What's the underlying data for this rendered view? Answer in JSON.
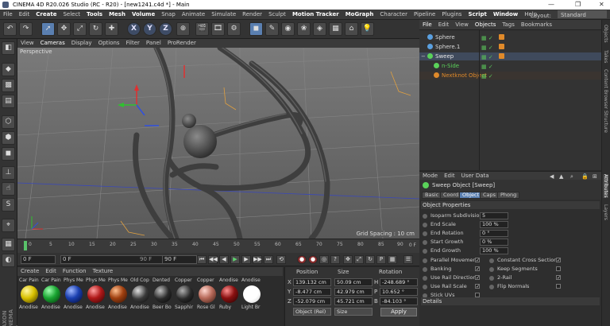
{
  "window": {
    "title": "CINEMA 4D R20.026 Studio (RC - R20) - [new1241.c4d *] - Main",
    "minimize": "—",
    "maximize": "❐",
    "close": "✕"
  },
  "menubar": {
    "items": [
      "File",
      "Edit",
      "Create",
      "Select",
      "Tools",
      "Mesh",
      "Volume",
      "Snap",
      "Animate",
      "Simulate",
      "Render",
      "Sculpt",
      "Motion Tracker",
      "MoGraph",
      "Character",
      "Pipeline",
      "Plugins",
      "Script",
      "Window",
      "Help"
    ],
    "highlighted": [
      "Create",
      "Tools",
      "Mesh",
      "Volume",
      "Motion Tracker",
      "MoGraph",
      "Script",
      "Window"
    ],
    "layout_label": "Layout:",
    "layout_value": "Standard"
  },
  "toolbar": {
    "xyz": [
      "X",
      "Y",
      "Z"
    ]
  },
  "viewport": {
    "menu": [
      "View",
      "Cameras",
      "Display",
      "Options",
      "Filter",
      "Panel",
      "ProRender"
    ],
    "label": "Perspective",
    "grid_spacing": "Grid Spacing : 10 cm",
    "background": "#6e6e6e",
    "tube_color": "#4a4a4a"
  },
  "timeline": {
    "ticks": [
      "0",
      "5",
      "10",
      "15",
      "20",
      "25",
      "30",
      "35",
      "40",
      "45",
      "50",
      "55",
      "60",
      "65",
      "70",
      "75",
      "80",
      "85",
      "90"
    ],
    "end_label": "0 F"
  },
  "transport": {
    "start": "0 F",
    "current": "0 F",
    "max_field": "90 F",
    "end": "90 F"
  },
  "materials": {
    "menu": [
      "Create",
      "Edit",
      "Function",
      "Texture"
    ],
    "items": [
      {
        "top": "Car Pain",
        "bottom": "Anodise",
        "color": "#d8c000"
      },
      {
        "top": "Car Pain",
        "bottom": "Anodise",
        "color": "#1aa532"
      },
      {
        "top": "Phys Me",
        "bottom": "Anodise",
        "color": "#1a3fb0"
      },
      {
        "top": "Phys Me",
        "bottom": "Anodise",
        "color": "#b01818"
      },
      {
        "top": "Phys Me",
        "bottom": "Anodise",
        "color": "#a04010"
      },
      {
        "top": "Old Cop",
        "bottom": "Anodise",
        "color": "#3a3a3a"
      },
      {
        "top": "Dented",
        "bottom": "Beer Bo",
        "color": "#2a2a2a"
      },
      {
        "top": "Copper",
        "bottom": "Sapphir",
        "color": "#2a2a2a"
      },
      {
        "top": "Copper",
        "bottom": "Rose Gl",
        "color": "#b86a5a"
      },
      {
        "top": "Anodise",
        "bottom": "Ruby",
        "color": "#8a1010"
      },
      {
        "top": "Anodise",
        "bottom": "Light Br",
        "color": "#ffffff"
      }
    ]
  },
  "coordinates": {
    "headers": [
      "Position",
      "Size",
      "Rotation"
    ],
    "rows": [
      {
        "axis": "X",
        "pos": "139.132 cm",
        "size": "50.09 cm",
        "rot_label": "H",
        "rot": "-248.689 °"
      },
      {
        "axis": "Y",
        "pos": "-8.477 cm",
        "size": "42.979 cm",
        "rot_label": "P",
        "rot": "10.652 °"
      },
      {
        "axis": "Z",
        "pos": "-52.079 cm",
        "size": "45.721 cm",
        "rot_label": "B",
        "rot": "-84.103 °"
      }
    ],
    "mode": "Object (Rel)",
    "size_mode": "Size",
    "apply": "Apply"
  },
  "object_manager": {
    "menu": [
      "File",
      "Edit",
      "View",
      "Objects",
      "Tags",
      "Bookmarks"
    ],
    "highlighted": [
      "Objects"
    ],
    "objects": [
      {
        "name": "Sphere",
        "indent": 0,
        "icon_color": "#5aa0e0",
        "text_color": "#d8d8d8",
        "selected": false
      },
      {
        "name": "Sphere.1",
        "indent": 0,
        "icon_color": "#5aa0e0",
        "text_color": "#d8d8d8",
        "selected": false
      },
      {
        "name": "Sweep",
        "indent": 0,
        "icon_color": "#5ad25a",
        "text_color": "#e8e8e8",
        "selected": true
      },
      {
        "name": "n-Side",
        "indent": 1,
        "icon_color": "#5ad25a",
        "text_color": "#5ad25a",
        "selected": false
      },
      {
        "name": "Nextknot Object",
        "indent": 1,
        "icon_color": "#e08a2a",
        "text_color": "#e08a2a",
        "selected": false
      }
    ]
  },
  "right_tabs": [
    "Objects",
    "Takes",
    "Content Browser",
    "Structure",
    "Attributes",
    "Layers"
  ],
  "attributes": {
    "menu": [
      "Mode",
      "Edit",
      "User Data"
    ],
    "title": "Sweep Object [Sweep]",
    "tabs": [
      "Basic",
      "Coord.",
      "Object",
      "Caps",
      "Phong"
    ],
    "active_tab": "Object",
    "section": "Object Properties",
    "fields": [
      {
        "label": "Isoparm Subdivision",
        "value": "5"
      },
      {
        "label": "End Scale",
        "value": "100 %"
      },
      {
        "label": "End Rotation",
        "value": "0 °"
      },
      {
        "label": "Start Growth",
        "value": "0 %"
      },
      {
        "label": "End Growth",
        "value": "100 %"
      }
    ],
    "checks_left": [
      {
        "label": "Parallel Movement",
        "checked": true
      },
      {
        "label": "Banking",
        "checked": true
      },
      {
        "label": "Use Rail Direction",
        "checked": true
      },
      {
        "label": "Use Rail Scale",
        "checked": true
      },
      {
        "label": "Stick UVs",
        "checked": false
      }
    ],
    "checks_right": [
      {
        "label": "Constant Cross Section",
        "checked": true
      },
      {
        "label": "Keep Segments",
        "checked": false
      },
      {
        "label": "2-Rail",
        "checked": true
      },
      {
        "label": "Flip Normals",
        "checked": false
      }
    ],
    "details": "Details"
  }
}
